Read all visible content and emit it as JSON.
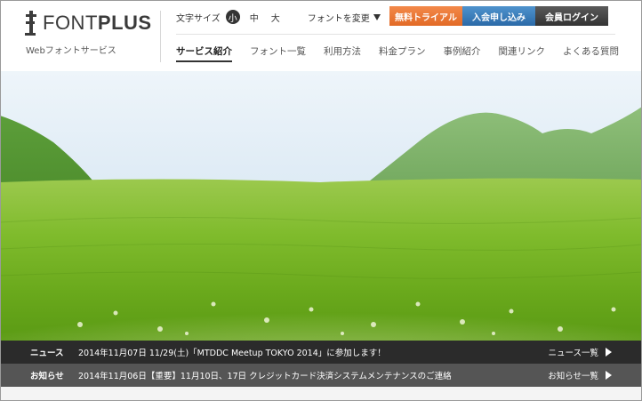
{
  "brand": {
    "logo_light": "FONT",
    "logo_bold": "PLUS",
    "tagline": "Webフォントサービス"
  },
  "utility": {
    "font_size_label": "文字サイズ",
    "sizes": [
      "小",
      "中",
      "大"
    ],
    "active_size": "小",
    "font_change_label": "フォントを変更"
  },
  "buttons": {
    "trial": "無料トライアル",
    "join": "入会申し込み",
    "login": "会員ログイン"
  },
  "nav": {
    "items": [
      "サービス紹介",
      "フォント一覧",
      "利用方法",
      "料金プラン",
      "事例紹介",
      "関連リンク",
      "よくある質問"
    ],
    "active_index": 0
  },
  "news": {
    "label": "ニュース",
    "text": "2014年11月07日 11/29(土)「MTDDC Meetup TOKYO 2014」に参加します！",
    "more": "ニュース一覧"
  },
  "notice": {
    "label": "お知らせ",
    "text": "2014年11月06日【重要】11月10日、17日 クレジットカード決済システムメンテナンスのご連絡",
    "more": "お知らせ一覧"
  },
  "colors": {
    "trial": "#e8742f",
    "join": "#3a7fbf",
    "login": "#444444",
    "news_bar": "#2b2b2b",
    "notice_bar": "#555555"
  }
}
